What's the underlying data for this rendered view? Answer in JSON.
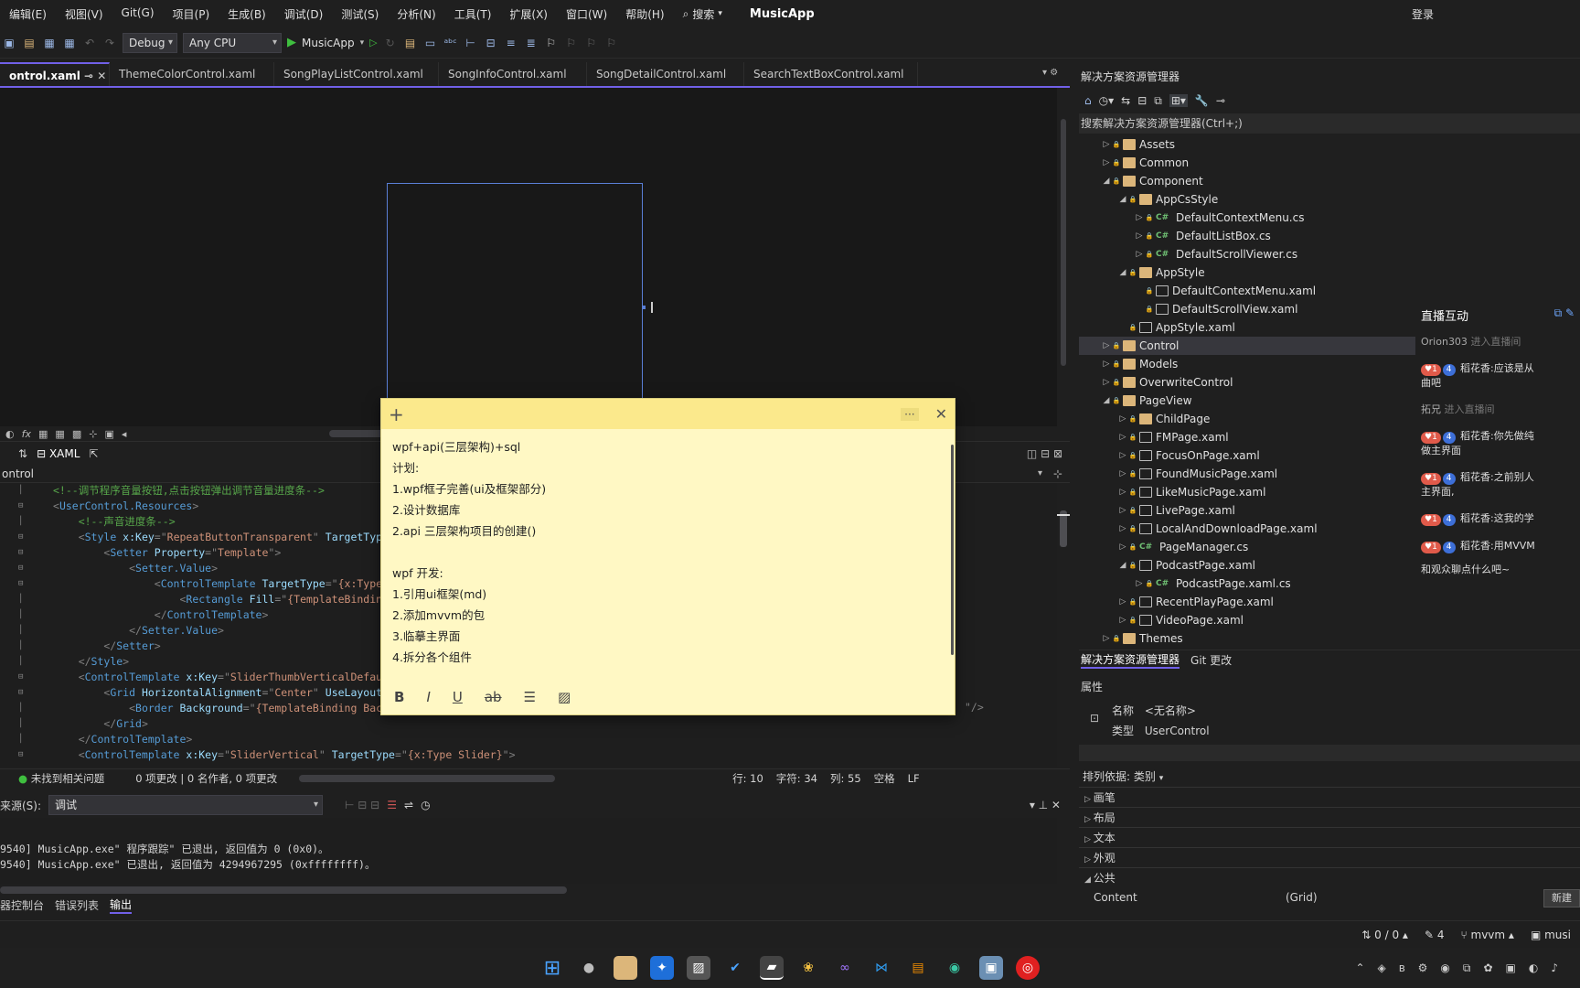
{
  "menubar": {
    "items": [
      "编辑(E)",
      "视图(V)",
      "Git(G)",
      "项目(P)",
      "生成(B)",
      "调试(D)",
      "测试(S)",
      "分析(N)",
      "工具(T)",
      "扩展(X)",
      "窗口(W)",
      "帮助(H)"
    ],
    "search_label": "搜索",
    "app_name": "MusicApp",
    "login_label": "登录"
  },
  "toolbar": {
    "config": "Debug",
    "platform": "Any CPU",
    "run_target": "MusicApp"
  },
  "doc_tabs": [
    "ontrol.xaml",
    "ThemeColorControl.xaml",
    "SongPlayListControl.xaml",
    "SongInfoControl.xaml",
    "SongDetailControl.xaml",
    "SearchTextBoxControl.xaml"
  ],
  "xaml_pane": {
    "tab_label": "XAML",
    "path_label": "ontrol"
  },
  "code_lines": [
    [
      [
        "com",
        "<!--调节程序音量按钮,点击按钮弹出调节音量进度条-->"
      ]
    ],
    [
      [
        "pun",
        "<"
      ],
      [
        "tag",
        "UserControl.Resources"
      ],
      [
        "pun",
        ">"
      ]
    ],
    [
      [
        "com",
        "    <!--声音进度条-->"
      ]
    ],
    [
      [
        "pun",
        "    <"
      ],
      [
        "tag",
        "Style "
      ],
      [
        "attr",
        "x:Key"
      ],
      [
        "pun",
        "=\""
      ],
      [
        "str",
        "RepeatButtonTransparent"
      ],
      [
        "pun",
        "\" "
      ],
      [
        "attr",
        "TargetTyp"
      ]
    ],
    [
      [
        "pun",
        "        <"
      ],
      [
        "tag",
        "Setter "
      ],
      [
        "attr",
        "Property"
      ],
      [
        "pun",
        "=\""
      ],
      [
        "str",
        "Template"
      ],
      [
        "pun",
        "\">"
      ]
    ],
    [
      [
        "pun",
        "            <"
      ],
      [
        "tag",
        "Setter.Value"
      ],
      [
        "pun",
        ">"
      ]
    ],
    [
      [
        "pun",
        "                <"
      ],
      [
        "tag",
        "ControlTemplate "
      ],
      [
        "attr",
        "TargetType"
      ],
      [
        "pun",
        "=\""
      ],
      [
        "str",
        "{x:Type"
      ]
    ],
    [
      [
        "pun",
        "                    <"
      ],
      [
        "tag",
        "Rectangle "
      ],
      [
        "attr",
        "Fill"
      ],
      [
        "pun",
        "=\""
      ],
      [
        "str",
        "{TemplateBindin"
      ]
    ],
    [
      [
        "pun",
        "                </"
      ],
      [
        "tag",
        "ControlTemplate"
      ],
      [
        "pun",
        ">"
      ]
    ],
    [
      [
        "pun",
        "            </"
      ],
      [
        "tag",
        "Setter.Value"
      ],
      [
        "pun",
        ">"
      ]
    ],
    [
      [
        "pun",
        "        </"
      ],
      [
        "tag",
        "Setter"
      ],
      [
        "pun",
        ">"
      ]
    ],
    [
      [
        "pun",
        "    </"
      ],
      [
        "tag",
        "Style"
      ],
      [
        "pun",
        ">"
      ]
    ],
    [
      [
        "pun",
        "    <"
      ],
      [
        "tag",
        "ControlTemplate "
      ],
      [
        "attr",
        "x:Key"
      ],
      [
        "pun",
        "=\""
      ],
      [
        "str",
        "SliderThumbVerticalDefau"
      ]
    ],
    [
      [
        "pun",
        "        <"
      ],
      [
        "tag",
        "Grid "
      ],
      [
        "attr",
        "HorizontalAlignment"
      ],
      [
        "pun",
        "=\""
      ],
      [
        "str",
        "Center"
      ],
      [
        "pun",
        "\" "
      ],
      [
        "attr",
        "UseLayout"
      ]
    ],
    [
      [
        "pun",
        "            <"
      ],
      [
        "tag",
        "Border "
      ],
      [
        "attr",
        "Background"
      ],
      [
        "pun",
        "=\""
      ],
      [
        "str",
        "{TemplateBinding Bac"
      ]
    ],
    [
      [
        "pun",
        "        </"
      ],
      [
        "tag",
        "Grid"
      ],
      [
        "pun",
        ">"
      ]
    ],
    [
      [
        "pun",
        "    </"
      ],
      [
        "tag",
        "ControlTemplate"
      ],
      [
        "pun",
        ">"
      ]
    ],
    [
      [
        "pun",
        "    <"
      ],
      [
        "tag",
        "ControlTemplate "
      ],
      [
        "attr",
        "x:Key"
      ],
      [
        "pun",
        "=\""
      ],
      [
        "str",
        "SliderVertical"
      ],
      [
        "pun",
        "\" "
      ],
      [
        "attr",
        "TargetType"
      ],
      [
        "pun",
        "=\""
      ],
      [
        "str",
        "{x:Type Slider}"
      ],
      [
        "pun",
        "\">"
      ]
    ]
  ],
  "code_tail": "\"/>",
  "editor_status": {
    "issues": "未找到相关问题",
    "changes": "0 项更改 | 0 名作者, 0 项更改",
    "line": "行: 10",
    "char": "字符: 34",
    "col": "列: 55",
    "space": "空格",
    "eol": "LF"
  },
  "output": {
    "source_label": "来源(S):",
    "source_value": "调试",
    "lines": [
      "9540] MusicApp.exe\" 程序跟踪\" 已退出, 返回值为 0 (0x0)。",
      "9540] MusicApp.exe\" 已退出, 返回值为 4294967295 (0xffffffff)。"
    ],
    "tabs": [
      "器控制台",
      "错误列表",
      "输出"
    ]
  },
  "solution_explorer": {
    "title": "解决方案资源管理器",
    "search_placeholder": "搜索解决方案资源管理器(Ctrl+;)",
    "tree": [
      {
        "d": 0,
        "arrow": "▷",
        "type": "folder",
        "label": "Assets"
      },
      {
        "d": 0,
        "arrow": "▷",
        "type": "folder",
        "label": "Common"
      },
      {
        "d": 0,
        "arrow": "◢",
        "type": "folder",
        "label": "Component"
      },
      {
        "d": 1,
        "arrow": "◢",
        "type": "folder",
        "label": "AppCsStyle"
      },
      {
        "d": 2,
        "arrow": "▷",
        "type": "cs",
        "label": "DefaultContextMenu.cs"
      },
      {
        "d": 2,
        "arrow": "▷",
        "type": "cs",
        "label": "DefaultListBox.cs"
      },
      {
        "d": 2,
        "arrow": "▷",
        "type": "cs",
        "label": "DefaultScrollViewer.cs"
      },
      {
        "d": 1,
        "arrow": "◢",
        "type": "folder",
        "label": "AppStyle"
      },
      {
        "d": 2,
        "arrow": "",
        "type": "xaml",
        "label": "DefaultContextMenu.xaml"
      },
      {
        "d": 2,
        "arrow": "",
        "type": "xaml",
        "label": "DefaultScrollView.xaml"
      },
      {
        "d": 1,
        "arrow": "",
        "type": "xaml",
        "label": "AppStyle.xaml"
      },
      {
        "d": 0,
        "arrow": "▷",
        "type": "folder",
        "label": "Control",
        "hl": true
      },
      {
        "d": 0,
        "arrow": "▷",
        "type": "folder",
        "label": "Models"
      },
      {
        "d": 0,
        "arrow": "▷",
        "type": "folder",
        "label": "OverwriteControl"
      },
      {
        "d": 0,
        "arrow": "◢",
        "type": "folder",
        "label": "PageView"
      },
      {
        "d": 1,
        "arrow": "▷",
        "type": "folder",
        "label": "ChildPage"
      },
      {
        "d": 1,
        "arrow": "▷",
        "type": "xaml",
        "label": "FMPage.xaml"
      },
      {
        "d": 1,
        "arrow": "▷",
        "type": "xaml",
        "label": "FocusOnPage.xaml"
      },
      {
        "d": 1,
        "arrow": "▷",
        "type": "xaml",
        "label": "FoundMusicPage.xaml"
      },
      {
        "d": 1,
        "arrow": "▷",
        "type": "xaml",
        "label": "LikeMusicPage.xaml"
      },
      {
        "d": 1,
        "arrow": "▷",
        "type": "xaml",
        "label": "LivePage.xaml"
      },
      {
        "d": 1,
        "arrow": "▷",
        "type": "xaml",
        "label": "LocalAndDownloadPage.xaml"
      },
      {
        "d": 1,
        "arrow": "▷",
        "type": "cs",
        "label": "PageManager.cs"
      },
      {
        "d": 1,
        "arrow": "◢",
        "type": "xaml",
        "label": "PodcastPage.xaml"
      },
      {
        "d": 2,
        "arrow": "▷",
        "type": "cs",
        "label": "PodcastPage.xaml.cs"
      },
      {
        "d": 1,
        "arrow": "▷",
        "type": "xaml",
        "label": "RecentPlayPage.xaml"
      },
      {
        "d": 1,
        "arrow": "▷",
        "type": "xaml",
        "label": "VideoPage.xaml"
      },
      {
        "d": 0,
        "arrow": "▷",
        "type": "folder",
        "label": "Themes"
      }
    ],
    "bottom_tabs": [
      "解决方案资源管理器",
      "Git 更改"
    ]
  },
  "properties": {
    "title": "属性",
    "name_label": "名称",
    "name_value": "<无名称>",
    "type_label": "类型",
    "type_value": "UserControl",
    "sort_label": "排列依据: 类别",
    "categories": [
      "画笔",
      "布局",
      "文本",
      "外观",
      "公共"
    ],
    "content_label": "Content",
    "content_value": "(Grid)",
    "new_button": "新建"
  },
  "live": {
    "title": "直播互动",
    "user1": "Orion303",
    "user1_action": "进入直播间",
    "msgs": [
      {
        "name": "稻花香:",
        "text": "应该是从",
        "text2": "曲吧"
      },
      {
        "name": "稻花香:",
        "text": "你先做纯",
        "text2": "做主界面"
      },
      {
        "name": "稻花香:",
        "text": "之前别人",
        "text2": "主界面,"
      },
      {
        "name": "稻花香:",
        "text": "这我的学",
        "text2": ""
      },
      {
        "name": "稻花香:",
        "text": "用MVVM",
        "text2": ""
      }
    ],
    "user2": "拓兄",
    "user2_action": "进入直播间",
    "badge_level": "4",
    "input_placeholder": "和观众聊点什么吧~"
  },
  "sticky_note": {
    "lines": [
      "wpf+api(三层架构)+sql",
      "计划:",
      "1.wpf框子完善(ui及框架部分)",
      "2.设计数据库",
      "2.api 三层架构项目的创建()",
      "",
      "wpf 开发:",
      "1.引用ui框架(md)",
      "2.添加mvvm的包",
      "3.临摹主界面",
      "4.拆分各个组件"
    ]
  },
  "statusbar": {
    "git_counts": "0 / 0",
    "pencil_count": "4",
    "branch": "mvvm",
    "repo": "musi"
  },
  "colors": {
    "accent": "#7160e8",
    "note_bg": "#fff8c4",
    "note_head": "#fbe98c"
  }
}
